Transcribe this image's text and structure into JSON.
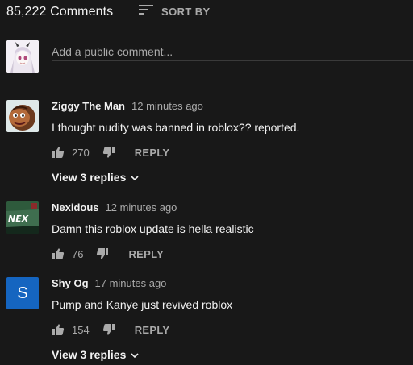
{
  "header": {
    "comment_count": "85,222 Comments",
    "sort_label": "SORT BY",
    "sort_icon": "sort-icon"
  },
  "add_comment": {
    "placeholder": "Add a public comment..."
  },
  "comments": [
    {
      "author": "Ziggy The Man",
      "time": "12 minutes ago",
      "text": "I thought nudity was banned in roblox?? reported.",
      "likes": "270",
      "reply_label": "REPLY",
      "view_replies": "View 3 replies"
    },
    {
      "author": "Nexidous",
      "time": "12 minutes ago",
      "text": "Damn this roblox update is hella realistic",
      "likes": "76",
      "reply_label": "REPLY",
      "avatar_text": "NEX"
    },
    {
      "author": "Shy Og",
      "time": "17 minutes ago",
      "text": "Pump and Kanye just revived roblox",
      "likes": "154",
      "reply_label": "REPLY",
      "view_replies": "View 3 replies",
      "avatar_letter": "S"
    }
  ],
  "colors": {
    "background": "#181818",
    "primary_text": "#f1f1f1",
    "secondary_text": "#aaaaaa",
    "avatar_blue": "#1565c0"
  }
}
